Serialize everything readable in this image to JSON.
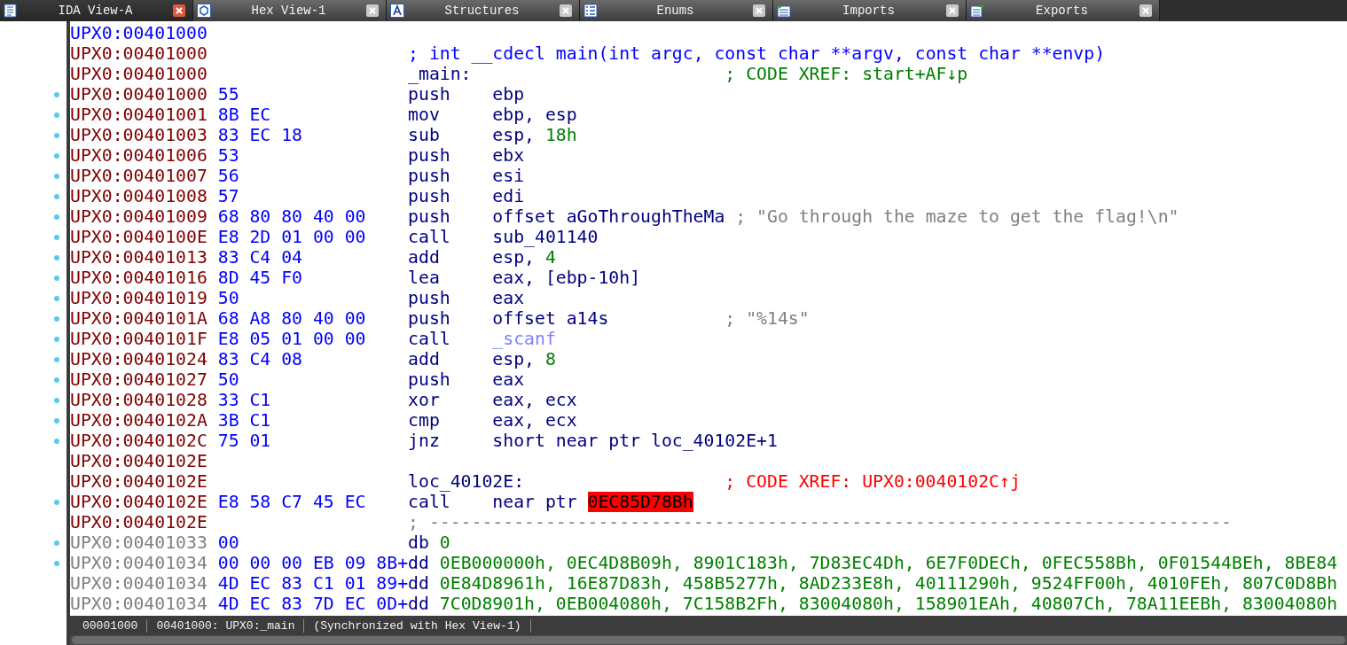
{
  "tabs": [
    {
      "label": "IDA View-A",
      "selected": true
    },
    {
      "label": "Hex View-1",
      "selected": false
    },
    {
      "label": "Structures",
      "selected": false
    },
    {
      "label": "Enums",
      "selected": false
    },
    {
      "label": "Imports",
      "selected": false
    },
    {
      "label": "Exports",
      "selected": false
    }
  ],
  "rows": [
    {
      "kind": "head",
      "address": "UPX0:00401000",
      "marker": false
    },
    {
      "kind": "comment",
      "address": "UPX0:00401000",
      "marker": false,
      "comment": {
        "text": "; int __cdecl main(int argc, const char **argv, const char **envp)",
        "kind": "plain"
      }
    },
    {
      "kind": "label",
      "address": "UPX0:00401000",
      "marker": false,
      "label": "_main:",
      "comment": {
        "text": "; CODE XREF: start+AF↓p",
        "kind": "xref"
      }
    },
    {
      "kind": "instruction",
      "address": "UPX0:00401000",
      "marker": true,
      "bytes": "55",
      "mnemonic": "push",
      "operands": [
        {
          "text": "ebp",
          "kind": "name"
        }
      ]
    },
    {
      "kind": "instruction",
      "address": "UPX0:00401001",
      "marker": true,
      "bytes": "8B EC",
      "mnemonic": "mov",
      "operands": [
        {
          "text": "ebp, esp",
          "kind": "name"
        }
      ]
    },
    {
      "kind": "instruction",
      "address": "UPX0:00401003",
      "marker": true,
      "bytes": "83 EC 18",
      "mnemonic": "sub",
      "operands": [
        {
          "text": "esp, ",
          "kind": "name"
        },
        {
          "text": "18h",
          "kind": "num"
        }
      ]
    },
    {
      "kind": "instruction",
      "address": "UPX0:00401006",
      "marker": true,
      "bytes": "53",
      "mnemonic": "push",
      "operands": [
        {
          "text": "ebx",
          "kind": "name"
        }
      ]
    },
    {
      "kind": "instruction",
      "address": "UPX0:00401007",
      "marker": true,
      "bytes": "56",
      "mnemonic": "push",
      "operands": [
        {
          "text": "esi",
          "kind": "name"
        }
      ]
    },
    {
      "kind": "instruction",
      "address": "UPX0:00401008",
      "marker": true,
      "bytes": "57",
      "mnemonic": "push",
      "operands": [
        {
          "text": "edi",
          "kind": "name"
        }
      ]
    },
    {
      "kind": "instruction",
      "address": "UPX0:00401009",
      "marker": true,
      "bytes": "68 80 80 40 00",
      "mnemonic": "push",
      "operands": [
        {
          "text": "offset aGoThroughTheMa",
          "kind": "name"
        }
      ],
      "comment": {
        "text": "; \"Go through the maze to get the flag!\\n\"",
        "kind": "string"
      }
    },
    {
      "kind": "instruction",
      "address": "UPX0:0040100E",
      "marker": true,
      "bytes": "E8 2D 01 00 00",
      "mnemonic": "call",
      "operands": [
        {
          "text": "sub_401140",
          "kind": "name"
        }
      ]
    },
    {
      "kind": "instruction",
      "address": "UPX0:00401013",
      "marker": true,
      "bytes": "83 C4 04",
      "mnemonic": "add",
      "operands": [
        {
          "text": "esp, ",
          "kind": "name"
        },
        {
          "text": "4",
          "kind": "num"
        }
      ]
    },
    {
      "kind": "instruction",
      "address": "UPX0:00401016",
      "marker": true,
      "bytes": "8D 45 F0",
      "mnemonic": "lea",
      "operands": [
        {
          "text": "eax, [ebp-10h]",
          "kind": "name"
        }
      ]
    },
    {
      "kind": "instruction",
      "address": "UPX0:00401019",
      "marker": true,
      "bytes": "50",
      "mnemonic": "push",
      "operands": [
        {
          "text": "eax",
          "kind": "name"
        }
      ]
    },
    {
      "kind": "instruction",
      "address": "UPX0:0040101A",
      "marker": true,
      "bytes": "68 A8 80 40 00",
      "mnemonic": "push",
      "operands": [
        {
          "text": "offset a14s",
          "kind": "name"
        }
      ],
      "comment": {
        "text": "; \"%14s\"",
        "kind": "string"
      }
    },
    {
      "kind": "instruction",
      "address": "UPX0:0040101F",
      "marker": true,
      "bytes": "E8 05 01 00 00",
      "mnemonic": "call",
      "operands": [
        {
          "text": "_scanf",
          "kind": "import"
        }
      ]
    },
    {
      "kind": "instruction",
      "address": "UPX0:00401024",
      "marker": true,
      "bytes": "83 C4 08",
      "mnemonic": "add",
      "operands": [
        {
          "text": "esp, ",
          "kind": "name"
        },
        {
          "text": "8",
          "kind": "num"
        }
      ]
    },
    {
      "kind": "instruction",
      "address": "UPX0:00401027",
      "marker": true,
      "bytes": "50",
      "mnemonic": "push",
      "operands": [
        {
          "text": "eax",
          "kind": "name"
        }
      ]
    },
    {
      "kind": "instruction",
      "address": "UPX0:00401028",
      "marker": true,
      "bytes": "33 C1",
      "mnemonic": "xor",
      "operands": [
        {
          "text": "eax, ecx",
          "kind": "name"
        }
      ]
    },
    {
      "kind": "instruction",
      "address": "UPX0:0040102A",
      "marker": true,
      "bytes": "3B C1",
      "mnemonic": "cmp",
      "operands": [
        {
          "text": "eax, ecx",
          "kind": "name"
        }
      ]
    },
    {
      "kind": "instruction",
      "address": "UPX0:0040102C",
      "marker": true,
      "bytes": "75 01",
      "mnemonic": "jnz",
      "operands": [
        {
          "text": "short near ptr loc_40102E+1",
          "kind": "name"
        }
      ]
    },
    {
      "kind": "blank",
      "address": "UPX0:0040102E",
      "marker": false
    },
    {
      "kind": "label",
      "address": "UPX0:0040102E",
      "marker": false,
      "label": "loc_40102E:",
      "comment": {
        "text": "; CODE XREF: UPX0:0040102C↑j",
        "kind": "xref_bad"
      }
    },
    {
      "kind": "instruction",
      "address": "UPX0:0040102E",
      "marker": true,
      "bytes": "E8 58 C7 45 EC",
      "mnemonic": "call",
      "operands": [
        {
          "text": "near ptr ",
          "kind": "name"
        },
        {
          "text": "0EC85D78Bh",
          "kind": "bad"
        }
      ]
    },
    {
      "kind": "comment",
      "address": "UPX0:0040102E",
      "marker": false,
      "comment": {
        "text": "; ----------------------------------------------------------------------------",
        "kind": "separator"
      }
    },
    {
      "kind": "data",
      "address": "UPX0:00401033",
      "marker": true,
      "bytes": "00",
      "mnemonic": "db",
      "operands": [
        {
          "text": "0",
          "kind": "num"
        }
      ]
    },
    {
      "kind": "data",
      "address": "UPX0:00401034",
      "marker": true,
      "bytes": "00 00 00 EB 09 8B+",
      "mnemonic": "dd",
      "operands": [
        {
          "text": "0EB000000h, 0EC4D8B09h, 8901C183h, 7D83EC4Dh, 6E7F0DECh, 0FEC558Bh, 0F01544BEh, 8BE84",
          "kind": "num"
        }
      ]
    },
    {
      "kind": "data",
      "address": "UPX0:00401034",
      "marker": false,
      "bytes": "4D EC 83 C1 01 89+",
      "mnemonic": "dd",
      "operands": [
        {
          "text": "0E84D8961h, 16E87D83h, 458B5277h, 8AD233E8h, 40111290h, 9524FF00h, 4010FEh, 807C0D8Bh",
          "kind": "num"
        }
      ]
    },
    {
      "kind": "data",
      "address": "UPX0:00401034",
      "marker": false,
      "bytes": "4D EC 83 7D EC 0D+",
      "mnemonic": "dd",
      "operands": [
        {
          "text": "7C0D8901h, 0EB004080h, 7C158B2Fh, 83004080h, 158901EAh, 40807Ch, 78A11EEBh, 83004080h",
          "kind": "num"
        }
      ]
    }
  ],
  "status_bar": {
    "fields": [
      "00001000",
      "00401000: UPX0:_main",
      "(Synchronized with Hex View-1)"
    ]
  }
}
